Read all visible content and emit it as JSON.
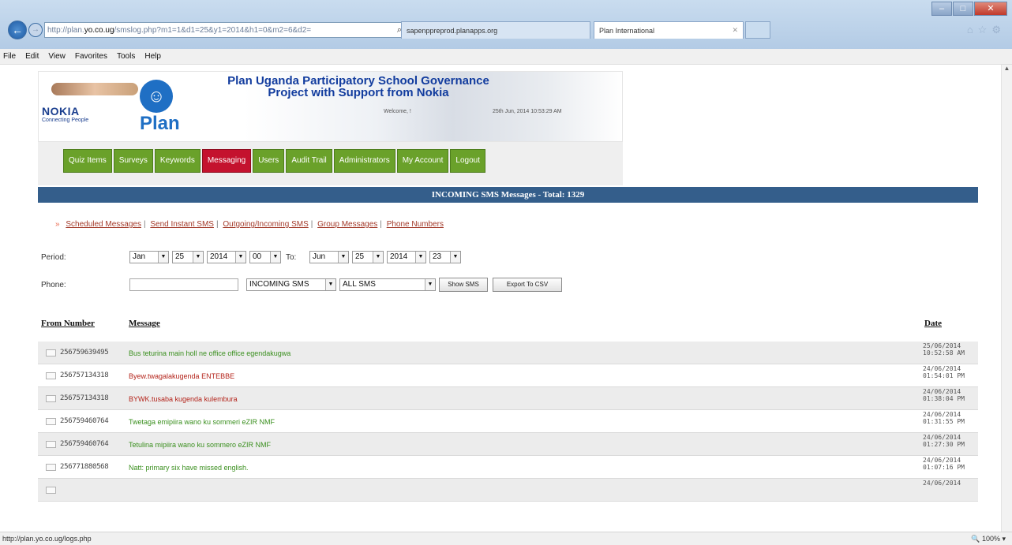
{
  "browser": {
    "url_prefix": "http://plan.",
    "url_domain": "yo.co.ug",
    "url_rest": "/smslog.php?m1=1&d1=25&y1=2014&h1=0&m2=6&d2=",
    "address_icons": "⌕ ▾ ⎗ ✕",
    "tabs": [
      {
        "title": "sapenppreprod.planapps.org"
      },
      {
        "title": "Plan International"
      }
    ],
    "menu": [
      "File",
      "Edit",
      "View",
      "Favorites",
      "Tools",
      "Help"
    ],
    "status_url": "http://plan.yo.co.ug/logs.php",
    "zoom": "100%"
  },
  "header": {
    "nokia": "NOKIA",
    "nokia_tag": "Connecting People",
    "plan": "Plan",
    "title_line1": "Plan Uganda Participatory  School Governance",
    "title_line2": "Project  with Support from Nokia",
    "welcome": "Welcome, !",
    "datetime": "25th Jun, 2014 10:53:29 AM"
  },
  "nav": [
    "Quiz Items",
    "Surveys",
    "Keywords",
    "Messaging",
    "Users",
    "Audit Trail",
    "Administrators",
    "My Account",
    "Logout"
  ],
  "section_title": "INCOMING SMS Messages - Total: 1329",
  "sublinks": [
    "Scheduled Messages",
    "Send Instant SMS",
    "Outgoing/Incoming SMS",
    "Group Messages",
    "Phone Numbers"
  ],
  "filters": {
    "period_label": "Period:",
    "from_month": "Jan",
    "from_day": "25",
    "from_year": "2014",
    "from_hour": "00",
    "to_label": "To:",
    "to_month": "Jun",
    "to_day": "25",
    "to_year": "2014",
    "to_hour": "23",
    "phone_label": "Phone:",
    "phone_value": "",
    "direction": "INCOMING SMS",
    "type": "ALL SMS",
    "show_btn": "Show SMS",
    "export_btn": "Export To CSV"
  },
  "table": {
    "col_from": "From Number",
    "col_message": "Message",
    "col_date": "Date",
    "rows": [
      {
        "from": "256759639495",
        "message": "Bus teturina main holl ne office office egendakugwa",
        "date": "25/06/2014 10:52:58 AM",
        "color": "green"
      },
      {
        "from": "256757134318",
        "message": "Byew.twagalakugenda ENTEBBE",
        "date": "24/06/2014 01:54:01 PM",
        "color": "red"
      },
      {
        "from": "256757134318",
        "message": "BYWK.tusaba kugenda kulembura",
        "date": "24/06/2014 01:38:04 PM",
        "color": "red"
      },
      {
        "from": "256759460764",
        "message": "Twetaga emipiira wano ku sommeri eZIR NMF",
        "date": "24/06/2014 01:31:55 PM",
        "color": "green"
      },
      {
        "from": "256759460764",
        "message": "Tetulina mipiira wano ku sommero eZIR NMF",
        "date": "24/06/2014 01:27:30 PM",
        "color": "green"
      },
      {
        "from": "256771880568",
        "message": "Natt: primary six have missed english.",
        "date": "24/06/2014 01:07:16 PM",
        "color": "green"
      },
      {
        "from": "",
        "message": "",
        "date": "24/06/2014",
        "color": "green"
      }
    ]
  },
  "colors": {
    "nav_green": "#6aa12a",
    "nav_active": "#c4122e",
    "section_bar": "#345e8b",
    "link": "#a33a2a"
  }
}
